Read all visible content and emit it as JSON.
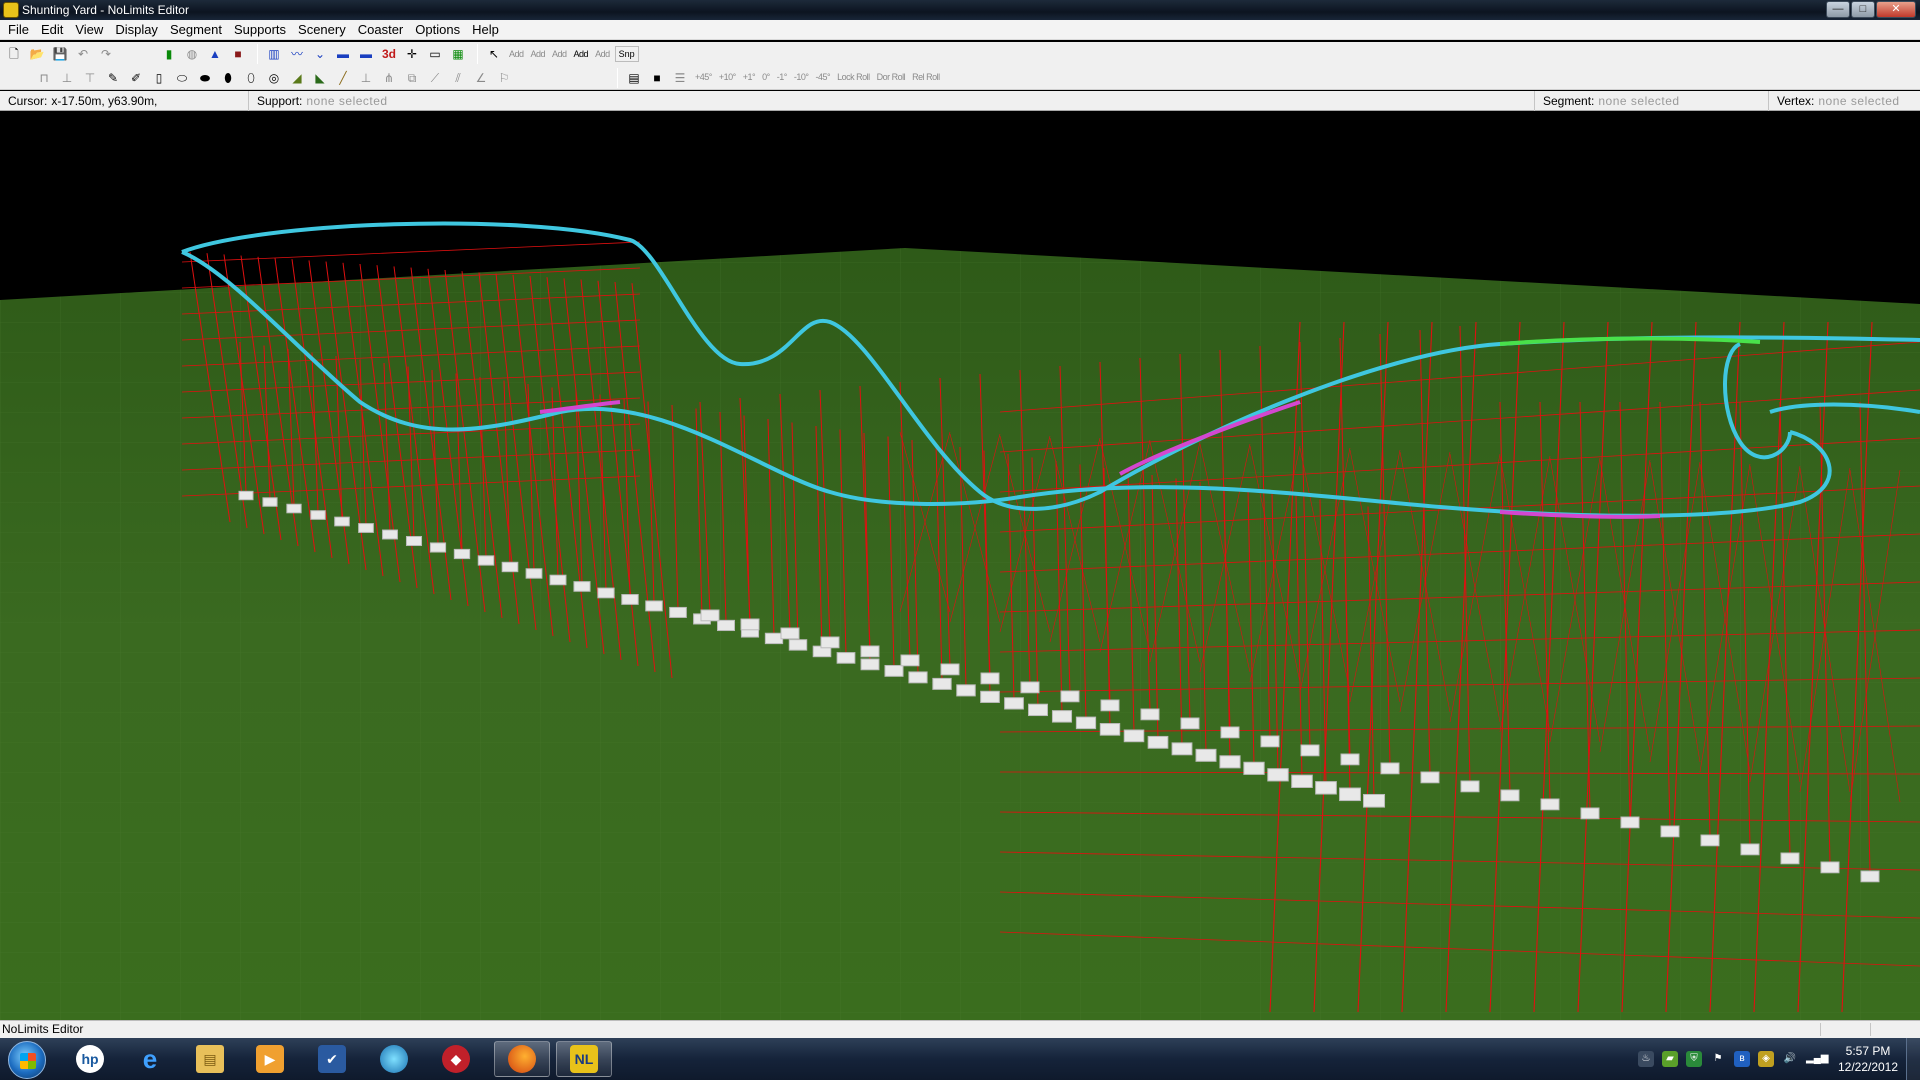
{
  "window": {
    "title": "Shunting Yard - NoLimits Editor",
    "buttons": {
      "minimize": "—",
      "maximize": "□",
      "close": "✕"
    }
  },
  "menu": [
    "File",
    "Edit",
    "View",
    "Display",
    "Segment",
    "Supports",
    "Scenery",
    "Coaster",
    "Options",
    "Help"
  ],
  "toolbar": {
    "add_labels": [
      "Add",
      "Add",
      "Add",
      "Add",
      "Add"
    ],
    "snap_label": "Snp",
    "angle_labels": [
      "+45°",
      "+10°",
      "+1°",
      "0°",
      "-1°",
      "-10°",
      "-45°"
    ],
    "roll_labels": [
      "Lock Roll",
      "Dor Roll",
      "Rel Roll"
    ]
  },
  "status": {
    "cursor_label": "Cursor:",
    "cursor_value": "x-17.50m, y63.90m,",
    "support_label": "Support:",
    "support_value": "none selected",
    "segment_label": "Segment:",
    "segment_value": "none selected",
    "vertex_label": "Vertex:",
    "vertex_value": "none selected"
  },
  "bottom_status": "NoLimits Editor",
  "taskbar": {
    "clock_time": "5:57 PM",
    "clock_date": "12/22/2012"
  },
  "colors": {
    "track": "#3fc7e0",
    "support": "#e01010",
    "grass": "#3e6b22",
    "highlight": "#d447d0",
    "selected": "#49e14a"
  },
  "icons": [
    "new-file-icon",
    "open-folder-icon",
    "save-icon",
    "undo-icon",
    "redo-icon",
    "windows-start-icon",
    "hp-icon",
    "internet-explorer-icon",
    "file-explorer-icon",
    "media-player-icon",
    "checkmark-app-icon",
    "globe-app-icon",
    "game-app-icon",
    "firefox-icon",
    "nolimits-icon"
  ]
}
